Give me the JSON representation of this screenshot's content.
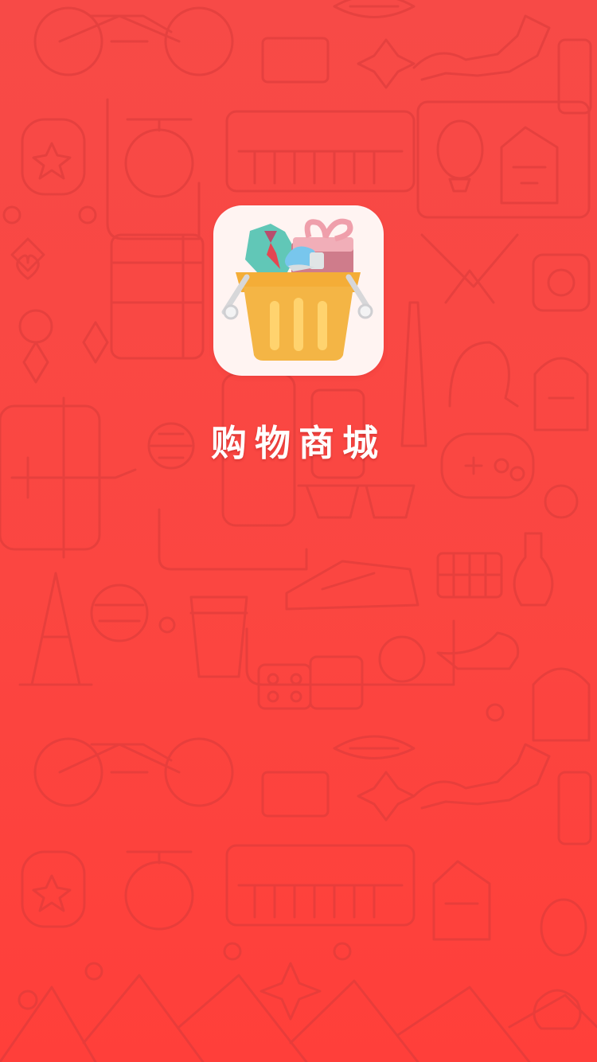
{
  "splash": {
    "app_name": "购物商城",
    "icon": "shopping-basket-icon",
    "background_color": "#ff4b45"
  }
}
